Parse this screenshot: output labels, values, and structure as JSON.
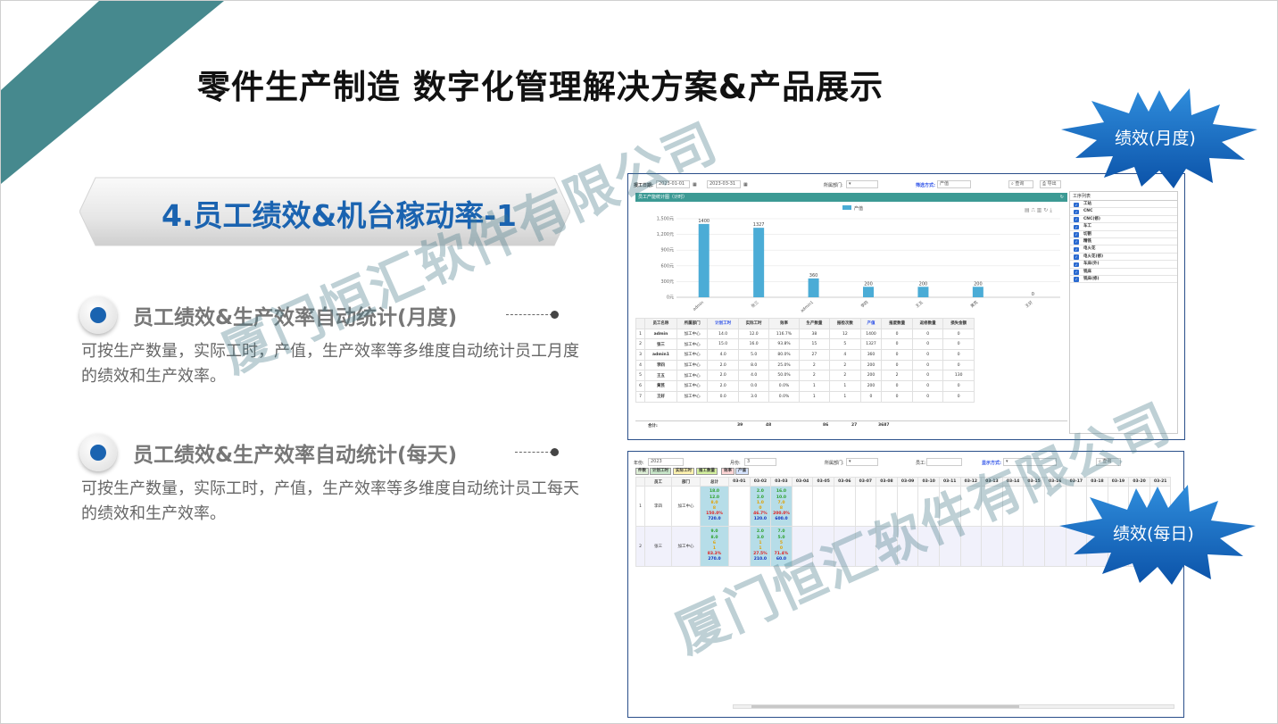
{
  "slide": {
    "title": "零件生产制造 数字化管理解决方案&产品展示",
    "section": "4.员工绩效&机台稼动率-1",
    "watermark": "厦门恒汇软件有限公司",
    "features": [
      {
        "title": "员工绩效&生产效率自动统计(月度)",
        "desc": "可按生产数量，实际工时，产值，生产效率等多维度自动统计员工月度的绩效和生产效率。"
      },
      {
        "title": "员工绩效&生产效率自动统计(每天)",
        "desc": "可按生产数量，实际工时，产值，生产效率等多维度自动统计员工每天的绩效和生产效率。"
      }
    ],
    "badges": {
      "monthly": "绩效(月度)",
      "daily": "绩效(每日)"
    },
    "colors": {
      "accent": "#1a63b0",
      "teal": "#3f8a8f",
      "badge": "#1670c0"
    }
  },
  "monthly": {
    "filters": {
      "date_label": "报工日期:",
      "date_from": "2023-01-01",
      "date_to": "2023-03-31",
      "dept_label": "所属部门:",
      "stat_label": "筛选方式:",
      "stat_value": "产值",
      "query": "查询",
      "export": "导出"
    },
    "panel_title": "员工产能统计图（计时）",
    "legend": "产值",
    "side_title": "工序列表",
    "processes": [
      "工站",
      "CNC",
      "CNC(修)",
      "车工",
      "切割",
      "精铣",
      "电火花",
      "电火花(修)",
      "车床(外)",
      "铣床",
      "铣床(修)"
    ],
    "columns": [
      "",
      "员工名称",
      "所属部门",
      "计划工时",
      "实际工时",
      "效率",
      "生产数量",
      "报检次数",
      "产值",
      "报废数量",
      "返修数量",
      "损失金额"
    ],
    "rows": [
      [
        "1",
        "admin",
        "加工中心",
        "14.0",
        "12.0",
        "116.7%",
        "38",
        "12",
        "1400",
        "0",
        "0",
        "0"
      ],
      [
        "2",
        "张三",
        "加工中心",
        "15.0",
        "16.0",
        "93.8%",
        "15",
        "5",
        "1327",
        "0",
        "0",
        "0"
      ],
      [
        "3",
        "admin1",
        "加工中心",
        "4.0",
        "5.0",
        "80.0%",
        "27",
        "4",
        "360",
        "0",
        "0",
        "0"
      ],
      [
        "4",
        "李四",
        "加工中心",
        "2.0",
        "8.0",
        "25.0%",
        "2",
        "2",
        "200",
        "0",
        "0",
        "0"
      ],
      [
        "5",
        "王五",
        "加工中心",
        "2.0",
        "4.0",
        "50.0%",
        "2",
        "2",
        "200",
        "2",
        "0",
        "130"
      ],
      [
        "6",
        "黄芪",
        "加工中心",
        "2.0",
        "0.0",
        "0.0%",
        "1",
        "1",
        "200",
        "0",
        "0",
        "0"
      ],
      [
        "7",
        "王好",
        "加工中心",
        "0.0",
        "3.0",
        "0.0%",
        "1",
        "1",
        "0",
        "0",
        "0",
        "0"
      ]
    ],
    "totals": {
      "label": "合计:",
      "planned": "39",
      "actual": "48",
      "qty": "86",
      "checks": "27",
      "value": "3687"
    }
  },
  "daily": {
    "filters": {
      "year_label": "年份:",
      "year": "2023",
      "month_label": "月份:",
      "month": "3",
      "dept_label": "所属部门:",
      "emp_label": "员工:",
      "show_label": "显示方式:",
      "query": "查询"
    },
    "buttons": [
      "件数",
      "计划工时",
      "实际工时",
      "报工数量",
      "效率",
      "产值"
    ],
    "columns": [
      "",
      "员工",
      "部门",
      "总计"
    ],
    "days": [
      "03-01",
      "03-02",
      "03-03",
      "03-04",
      "03-05",
      "03-06",
      "03-07",
      "03-08",
      "03-09",
      "03-10",
      "03-11",
      "03-12",
      "03-13",
      "03-14",
      "03-15",
      "03-16",
      "03-17",
      "03-18",
      "03-19",
      "03-20",
      "03-21"
    ],
    "rows": [
      {
        "no": "1",
        "name": "李四",
        "dept": "加工中心",
        "total": [
          "18.0",
          "12.0",
          "8.0",
          "8",
          "150.0%",
          "720.0"
        ],
        "d02": [
          "2.0",
          "2.0",
          "1.0",
          "0",
          "46.7%",
          "120.0"
        ],
        "d03": [
          "16.0",
          "10.0",
          "7.0",
          "8",
          "200.0%",
          "600.0"
        ]
      },
      {
        "no": "2",
        "name": "张三",
        "dept": "加工中心",
        "total": [
          "9.0",
          "8.0",
          "6",
          "1",
          "83.3%",
          "270.0"
        ],
        "d02": [
          "2.0",
          "3.0",
          "1",
          "1",
          "27.5%",
          "210.0"
        ],
        "d03": [
          "7.0",
          "5.0",
          "5",
          "0",
          "71.4%",
          "60.0"
        ]
      }
    ]
  },
  "chart_data": {
    "type": "bar",
    "title": "员工产能统计图（计时）",
    "categories": [
      "admin",
      "张三",
      "admin1",
      "李四",
      "王五",
      "黄芪",
      "王好"
    ],
    "series": [
      {
        "name": "产值",
        "values": [
          1400,
          1327,
          360,
          200,
          200,
          200,
          0
        ]
      }
    ],
    "ylim": [
      0,
      1500
    ],
    "yticks": [
      "0元",
      "300元",
      "600元",
      "900元",
      "1,200元",
      "1,500元"
    ],
    "grid": true,
    "legend": "top-center"
  }
}
